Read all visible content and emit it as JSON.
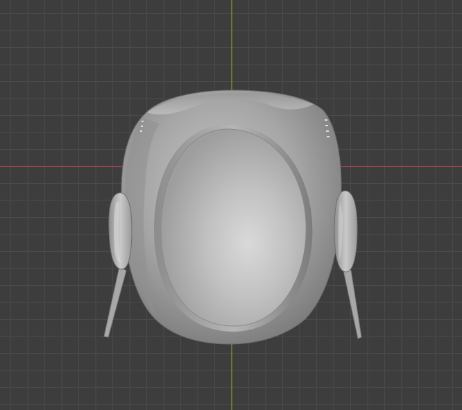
{
  "viewport": {
    "background_color": "#3d3d3d",
    "grid_minor_color": "#4a4a4a",
    "grid_major_color": "#353535",
    "x_axis_color": "#c44a55",
    "y_axis_color": "#7a9a2e",
    "show_grid": true,
    "show_axes": true
  },
  "object": {
    "name_icon": "helmet-mesh",
    "shading": "solid",
    "base_color": "#a9a9a9",
    "visor_color": "#c4c4c4",
    "shadow_color": "#6e6e6e"
  }
}
